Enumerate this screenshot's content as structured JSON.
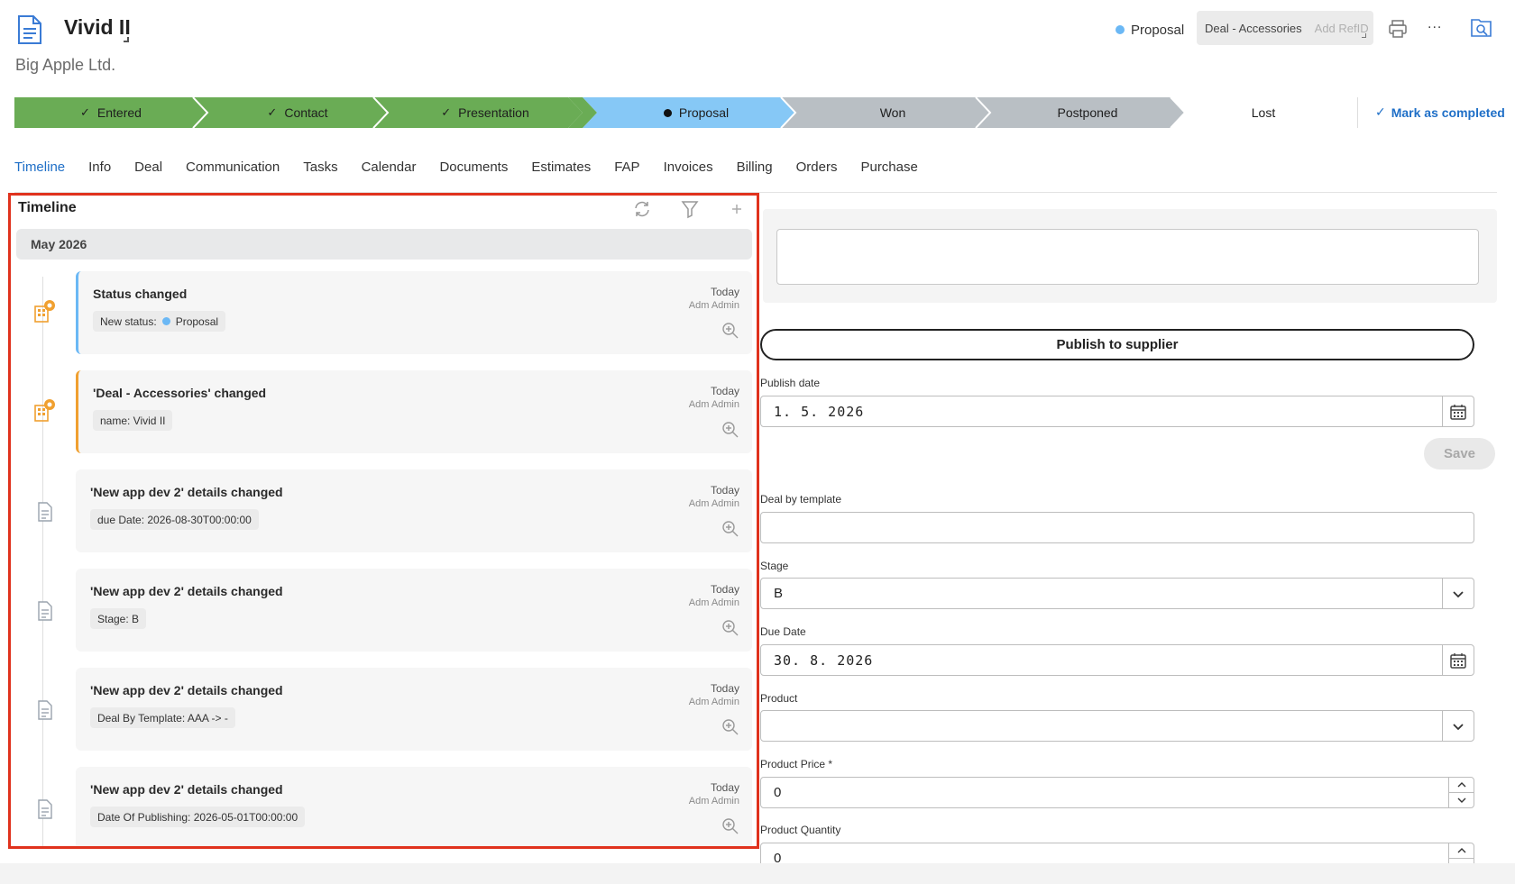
{
  "header": {
    "title": "Vivid II",
    "subtitle": "Big Apple Ltd.",
    "status": "Proposal",
    "deal_type": "Deal - Accessories",
    "ref_placeholder": "Add RefID",
    "more": "...",
    "icons": [
      "document-icon",
      "print-icon",
      "more-icon",
      "search-document-icon"
    ]
  },
  "stages": [
    {
      "label": "Entered",
      "state": "done"
    },
    {
      "label": "Contact",
      "state": "done"
    },
    {
      "label": "Presentation",
      "state": "done"
    },
    {
      "label": "Proposal",
      "state": "current"
    },
    {
      "label": "Won",
      "state": "todo"
    },
    {
      "label": "Postponed",
      "state": "todo"
    },
    {
      "label": "Lost",
      "state": "todo"
    }
  ],
  "mark_completed": "Mark as completed",
  "tabs": [
    "Timeline",
    "Info",
    "Deal",
    "Communication",
    "Tasks",
    "Calendar",
    "Documents",
    "Estimates",
    "FAP",
    "Invoices",
    "Billing",
    "Orders",
    "Purchase"
  ],
  "active_tab": "Timeline",
  "timeline": {
    "title": "Timeline",
    "month": "May 2026",
    "entries": [
      {
        "title": "Status changed",
        "tag": "New status:",
        "tag_value": "Proposal",
        "date": "Today",
        "user": "Adm Admin",
        "accent": "blue",
        "icon": "building-icon"
      },
      {
        "title": "'Deal - Accessories' changed",
        "tag": "name: Vivid II",
        "date": "Today",
        "user": "Adm Admin",
        "accent": "orange",
        "icon": "building-icon"
      },
      {
        "title": "'New app dev 2' details changed",
        "tag": "due Date: 2026-08-30T00:00:00",
        "date": "Today",
        "user": "Adm Admin",
        "accent": "none",
        "icon": "document-icon"
      },
      {
        "title": "'New app dev 2' details changed",
        "tag": "Stage: B",
        "date": "Today",
        "user": "Adm Admin",
        "accent": "none",
        "icon": "document-icon"
      },
      {
        "title": "'New app dev 2' details changed",
        "tag": "Deal By Template: AAA -> -",
        "date": "Today",
        "user": "Adm Admin",
        "accent": "none",
        "icon": "document-icon"
      },
      {
        "title": "'New app dev 2' details changed",
        "tag": "Date Of Publishing: 2026-05-01T00:00:00",
        "date": "Today",
        "user": "Adm Admin",
        "accent": "none",
        "icon": "document-icon"
      }
    ]
  },
  "form": {
    "publish_button": "Publish to supplier",
    "publish_date_label": "Publish date",
    "publish_date_value": "1. 5. 2026",
    "save_button": "Save",
    "deal_template_label": "Deal by template",
    "deal_template_value": "",
    "stage_label": "Stage",
    "stage_value": "B",
    "due_date_label": "Due Date",
    "due_date_value": "30. 8. 2026",
    "product_label": "Product",
    "product_value": "",
    "product_price_label": "Product Price",
    "required_mark": "*",
    "product_price_value": "0",
    "product_quantity_label": "Product Quantity",
    "product_quantity_value": "0"
  },
  "colors": {
    "stage_done": "#6aac55",
    "stage_current": "#86c8f6",
    "stage_todo": "#b9bfc4",
    "accent_blue": "#1f6fc7",
    "highlight_border": "#e0321d"
  }
}
